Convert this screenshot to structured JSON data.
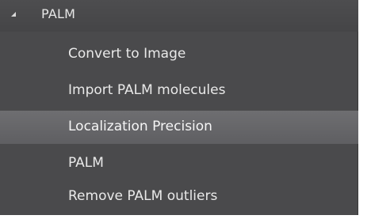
{
  "tree": {
    "group": {
      "label": "PALM",
      "expanded": true,
      "expander_icon": "triangle-expanded-icon"
    },
    "items": [
      {
        "label": "Convert to Image",
        "selected": false
      },
      {
        "label": "Import PALM molecules",
        "selected": false
      },
      {
        "label": "Localization Precision",
        "selected": true
      },
      {
        "label": "PALM",
        "selected": false
      },
      {
        "label": "Remove PALM outliers",
        "selected": false
      }
    ]
  },
  "colors": {
    "panel_bg": "#4a4a4c",
    "selected_bg": "#666669",
    "text": "#e9e9e9"
  }
}
